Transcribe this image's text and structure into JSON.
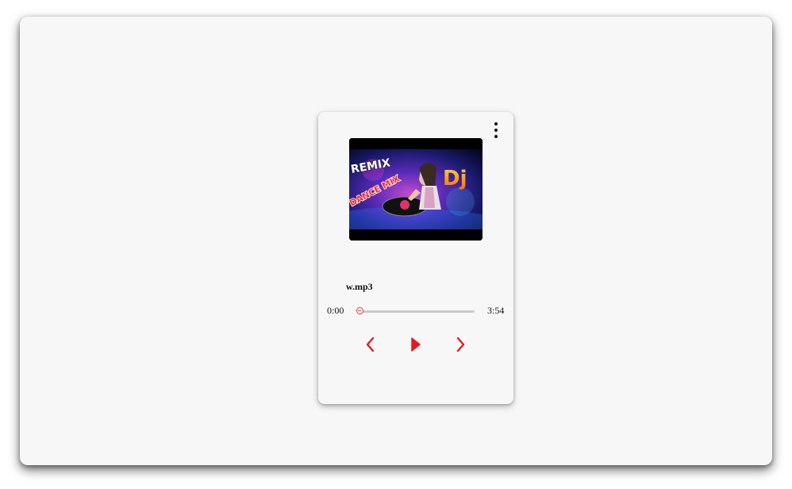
{
  "player": {
    "track_name": "w.mp3",
    "current_time": "0:00",
    "total_time": "3:54",
    "progress": 0.0,
    "accent_color": "#e53935",
    "cover_art": {
      "text_remix": "REMIX",
      "text_dance_mix": "DANCE MIX",
      "text_dj": "Dj"
    },
    "icons": {
      "menu": "more-vertical-icon",
      "prev": "chevron-left-icon",
      "play": "play-icon",
      "next": "chevron-right-icon"
    }
  }
}
